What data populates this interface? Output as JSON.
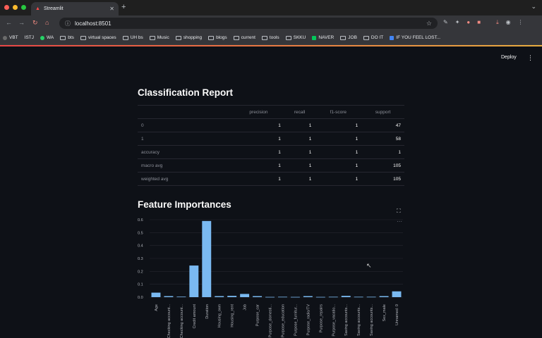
{
  "browser": {
    "tab_title": "Streamlit",
    "url": "localhost:8501",
    "bookmarks": [
      "VBT",
      "ISTJ",
      "WA",
      "bts",
      "virtual spaces",
      "UH bs",
      "Music",
      "shopping",
      "blogs",
      "current",
      "tools",
      "SKKU",
      "NAVER",
      "JOB",
      "DO IT",
      "IF YOU FEEL LOST..."
    ]
  },
  "app": {
    "deploy_label": "Deploy",
    "report_title": "Classification Report",
    "features_title": "Feature Importances"
  },
  "report": {
    "columns": [
      "",
      "precision",
      "recall",
      "f1-score",
      "support"
    ],
    "rows": [
      [
        "0",
        "1",
        "1",
        "1",
        "47"
      ],
      [
        "1",
        "1",
        "1",
        "1",
        "58"
      ],
      [
        "accuracy",
        "1",
        "1",
        "1",
        "1"
      ],
      [
        "macro avg",
        "1",
        "1",
        "1",
        "105"
      ],
      [
        "weighted avg",
        "1",
        "1",
        "1",
        "105"
      ]
    ]
  },
  "colors": {
    "bar": "#7ab9f1",
    "background": "#0e1117",
    "accent": "#ff4b4b"
  },
  "chart_data": {
    "type": "bar",
    "categories": [
      "Age",
      "Checking account...",
      "Checking account...",
      "Credit amount",
      "Duration",
      "Housing_own",
      "Housing_rent",
      "Job",
      "Purpose_car",
      "Purpose_domesti...",
      "Purpose_education",
      "Purpose_furnitur...",
      "Purpose_radio/TV",
      "Purpose_repairs",
      "Purpose_vacatio...",
      "Saving accounts...",
      "Saving accounts...",
      "Saving accounts...",
      "Sex_male",
      "Unnamed: 0"
    ],
    "values": [
      0.035,
      0.008,
      0.004,
      0.245,
      0.59,
      0.008,
      0.01,
      0.025,
      0.008,
      0.002,
      0.003,
      0.002,
      0.008,
      0.002,
      0.003,
      0.01,
      0.003,
      0.003,
      0.008,
      0.045
    ],
    "yticks": [
      "0.0",
      "0.1",
      "0.2",
      "0.3",
      "0.4",
      "0.5",
      "0.6"
    ],
    "ylim": [
      0,
      0.6
    ]
  }
}
